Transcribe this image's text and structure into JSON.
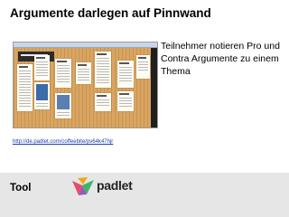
{
  "slide": {
    "title": "Argumente darlegen auf Pinnwand",
    "description": "Teilnehmer notieren Pro und Contra Argumente zu einem Thema",
    "link": "http://de.padlet.com/coffeebite/pv64k47hjr"
  },
  "screenshot": {
    "alt": "Padlet-Pinnwand mit Notizen auf Holzhintergrund"
  },
  "footer": {
    "label": "Tool",
    "logo_text": "padlet",
    "logo_colors": [
      "#e74c6f",
      "#f3a712",
      "#3fb56b",
      "#9b59b6"
    ]
  },
  "colors": {
    "link": "#1a3cb5",
    "footer_bg": "#e6e6e6"
  }
}
